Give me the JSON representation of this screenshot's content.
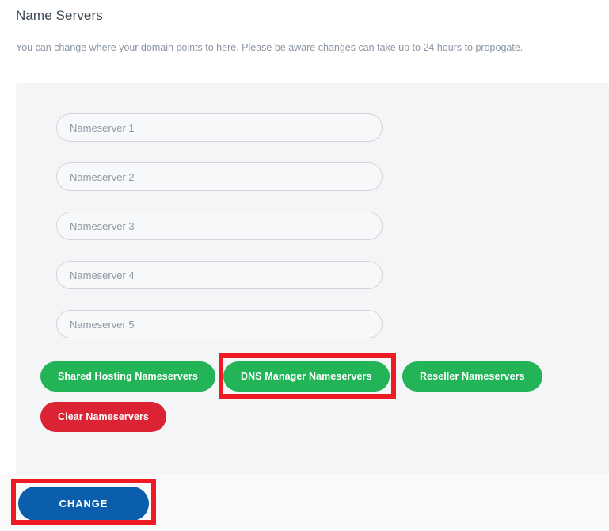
{
  "page": {
    "title": "Name Servers",
    "description": "You can change where your domain points to here. Please be aware changes can take up to 24 hours to propogate."
  },
  "colors": {
    "page_background": "#ffffff",
    "panel_background": "#f4f5f7",
    "footer_background": "#fafafa",
    "title_text": "#3d4852",
    "description_text": "#8a95a1",
    "input_border": "#d2d4d7",
    "input_background": "#f7f8f9",
    "placeholder_text": "#8d98a4",
    "green_button": "#23b457",
    "red_button": "#dc2333",
    "primary_button": "#0a5eab",
    "highlight_outline": "#ee1b24"
  },
  "nameserver_fields": [
    {
      "name": "nameserver-1",
      "placeholder": "Nameserver 1",
      "value": ""
    },
    {
      "name": "nameserver-2",
      "placeholder": "Nameserver 2",
      "value": ""
    },
    {
      "name": "nameserver-3",
      "placeholder": "Nameserver 3",
      "value": ""
    },
    {
      "name": "nameserver-4",
      "placeholder": "Nameserver 4",
      "value": ""
    },
    {
      "name": "nameserver-5",
      "placeholder": "Nameserver 5",
      "value": ""
    }
  ],
  "preset_buttons": [
    {
      "label": "Shared Hosting Nameservers",
      "style": "green",
      "highlighted": false
    },
    {
      "label": "DNS Manager Nameservers",
      "style": "green",
      "highlighted": true
    },
    {
      "label": "Reseller Nameservers",
      "style": "green",
      "highlighted": false
    },
    {
      "label": "Clear Nameservers",
      "style": "red",
      "highlighted": false
    }
  ],
  "submit": {
    "label": "CHANGE",
    "highlighted": true
  },
  "annotations": [
    {
      "target": "DNS Manager Nameservers",
      "shape": "rectangle",
      "color": "#ee1b24"
    },
    {
      "target": "CHANGE",
      "shape": "rectangle",
      "color": "#ee1b24"
    }
  ]
}
